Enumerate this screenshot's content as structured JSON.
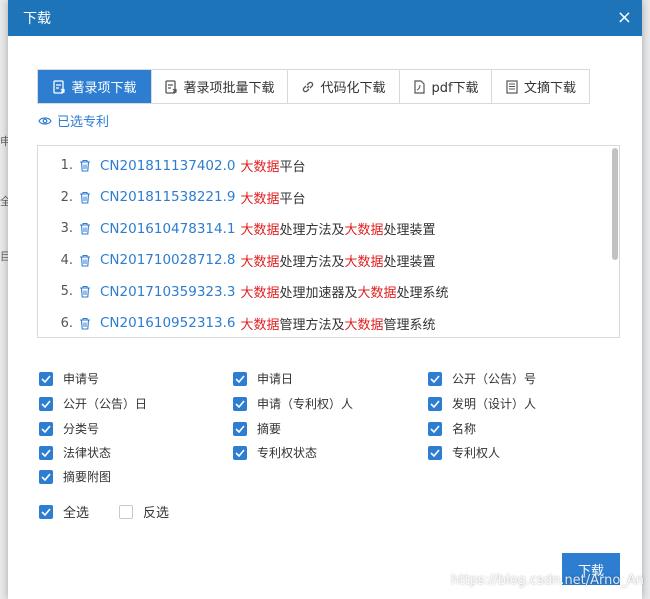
{
  "dialog": {
    "title": "下载",
    "close_symbol": "×"
  },
  "tabs": [
    {
      "label": "著录项下载",
      "icon": "export-doc-icon",
      "active": true
    },
    {
      "label": "著录项批量下载",
      "icon": "batch-export-icon",
      "active": false
    },
    {
      "label": "代码化下载",
      "icon": "link-icon",
      "active": false
    },
    {
      "label": "pdf下载",
      "icon": "pdf-file-icon",
      "active": false
    },
    {
      "label": "文摘下载",
      "icon": "abstract-doc-icon",
      "active": false
    }
  ],
  "selected_patents_link": "已选专利",
  "patents": [
    {
      "index": "1.",
      "number": "CN201811137402.0",
      "title_parts": [
        {
          "t": "大数据",
          "hl": true
        },
        {
          "t": "平台",
          "hl": false
        }
      ]
    },
    {
      "index": "2.",
      "number": "CN201811538221.9",
      "title_parts": [
        {
          "t": "大数据",
          "hl": true
        },
        {
          "t": "平台",
          "hl": false
        }
      ]
    },
    {
      "index": "3.",
      "number": "CN201610478314.1",
      "title_parts": [
        {
          "t": "大数据",
          "hl": true
        },
        {
          "t": "处理方法及",
          "hl": false
        },
        {
          "t": "大数据",
          "hl": true
        },
        {
          "t": "处理装置",
          "hl": false
        }
      ]
    },
    {
      "index": "4.",
      "number": "CN201710028712.8",
      "title_parts": [
        {
          "t": "大数据",
          "hl": true
        },
        {
          "t": "处理方法及",
          "hl": false
        },
        {
          "t": "大数据",
          "hl": true
        },
        {
          "t": "处理装置",
          "hl": false
        }
      ]
    },
    {
      "index": "5.",
      "number": "CN201710359323.3",
      "title_parts": [
        {
          "t": "大数据",
          "hl": true
        },
        {
          "t": "处理加速器及",
          "hl": false
        },
        {
          "t": "大数据",
          "hl": true
        },
        {
          "t": "处理系统",
          "hl": false
        }
      ]
    },
    {
      "index": "6.",
      "number": "CN201610952313.6",
      "title_parts": [
        {
          "t": "大数据",
          "hl": true
        },
        {
          "t": "管理方法及",
          "hl": false
        },
        {
          "t": "大数据",
          "hl": true
        },
        {
          "t": "管理系统",
          "hl": false
        }
      ]
    }
  ],
  "fields": [
    {
      "label": "申请号",
      "checked": true
    },
    {
      "label": "申请日",
      "checked": true
    },
    {
      "label": "公开（公告）号",
      "checked": true
    },
    {
      "label": "公开（公告）日",
      "checked": true
    },
    {
      "label": "申请（专利权）人",
      "checked": true
    },
    {
      "label": "发明（设计）人",
      "checked": true
    },
    {
      "label": "分类号",
      "checked": true
    },
    {
      "label": "摘要",
      "checked": true
    },
    {
      "label": "名称",
      "checked": true
    },
    {
      "label": "法律状态",
      "checked": true
    },
    {
      "label": "专利权状态",
      "checked": true
    },
    {
      "label": "专利权人",
      "checked": true
    },
    {
      "label": "摘要附图",
      "checked": true
    }
  ],
  "select_all": {
    "label": "全选",
    "checked": true
  },
  "invert_select": {
    "label": "反选",
    "checked": false
  },
  "download_button": "下载",
  "watermark": "https://blog.csdn.net/Arno_An",
  "background_texts": [
    "申",
    "全",
    "目"
  ],
  "colors": {
    "titlebar": "#1e74b8",
    "accent": "#2d7dd0",
    "highlight": "#e02020"
  }
}
